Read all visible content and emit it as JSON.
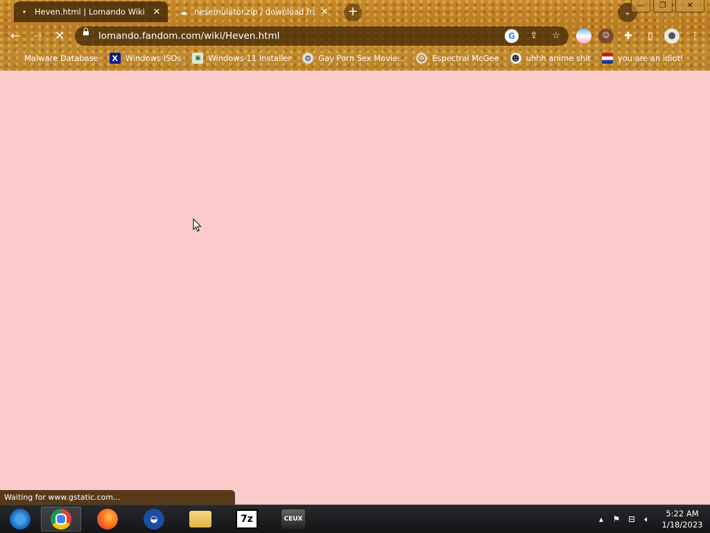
{
  "browser": {
    "tabs": [
      {
        "title": "Heven.html | Lomando Wiki | Fandom",
        "favicon": "fandom-dot-icon",
        "active": true
      },
      {
        "title": "nesemulator.zip / download from",
        "favicon": "cloud-upload-icon",
        "active": false
      }
    ],
    "new_tab": "+",
    "tab_search": "⌄",
    "window_controls": {
      "minimize": "—",
      "restore": "❐",
      "close": "✕"
    },
    "url": "lomando.fandom.com/wiki/Heven.html",
    "bookmarks": [
      {
        "label": "Malware Database",
        "icon": "none"
      },
      {
        "label": "Windows ISOs",
        "icon": "x-logo-icon"
      },
      {
        "label": "Windows 11 Installer",
        "icon": "image-icon"
      },
      {
        "label": "Gay Porn Sex Movie...",
        "icon": "gear-icon"
      },
      {
        "label": "Espectral McGee",
        "icon": "face-icon"
      },
      {
        "label": "uhhh anime shit",
        "icon": "anime-face-icon"
      },
      {
        "label": "you are an idiot!",
        "icon": "flag-icon"
      }
    ]
  },
  "page": {
    "background": "#fbcaca",
    "status_text": "Waiting for www.gstatic.com..."
  },
  "taskbar": {
    "apps": [
      "start-orb",
      "chrome",
      "firefox",
      "obama-app",
      "file-explorer",
      "7-zip",
      "ceux"
    ],
    "seven_zip_label": "7z",
    "ceux_label": "CEUX",
    "clock_time": "5:22 AM",
    "clock_date": "1/18/2023"
  }
}
